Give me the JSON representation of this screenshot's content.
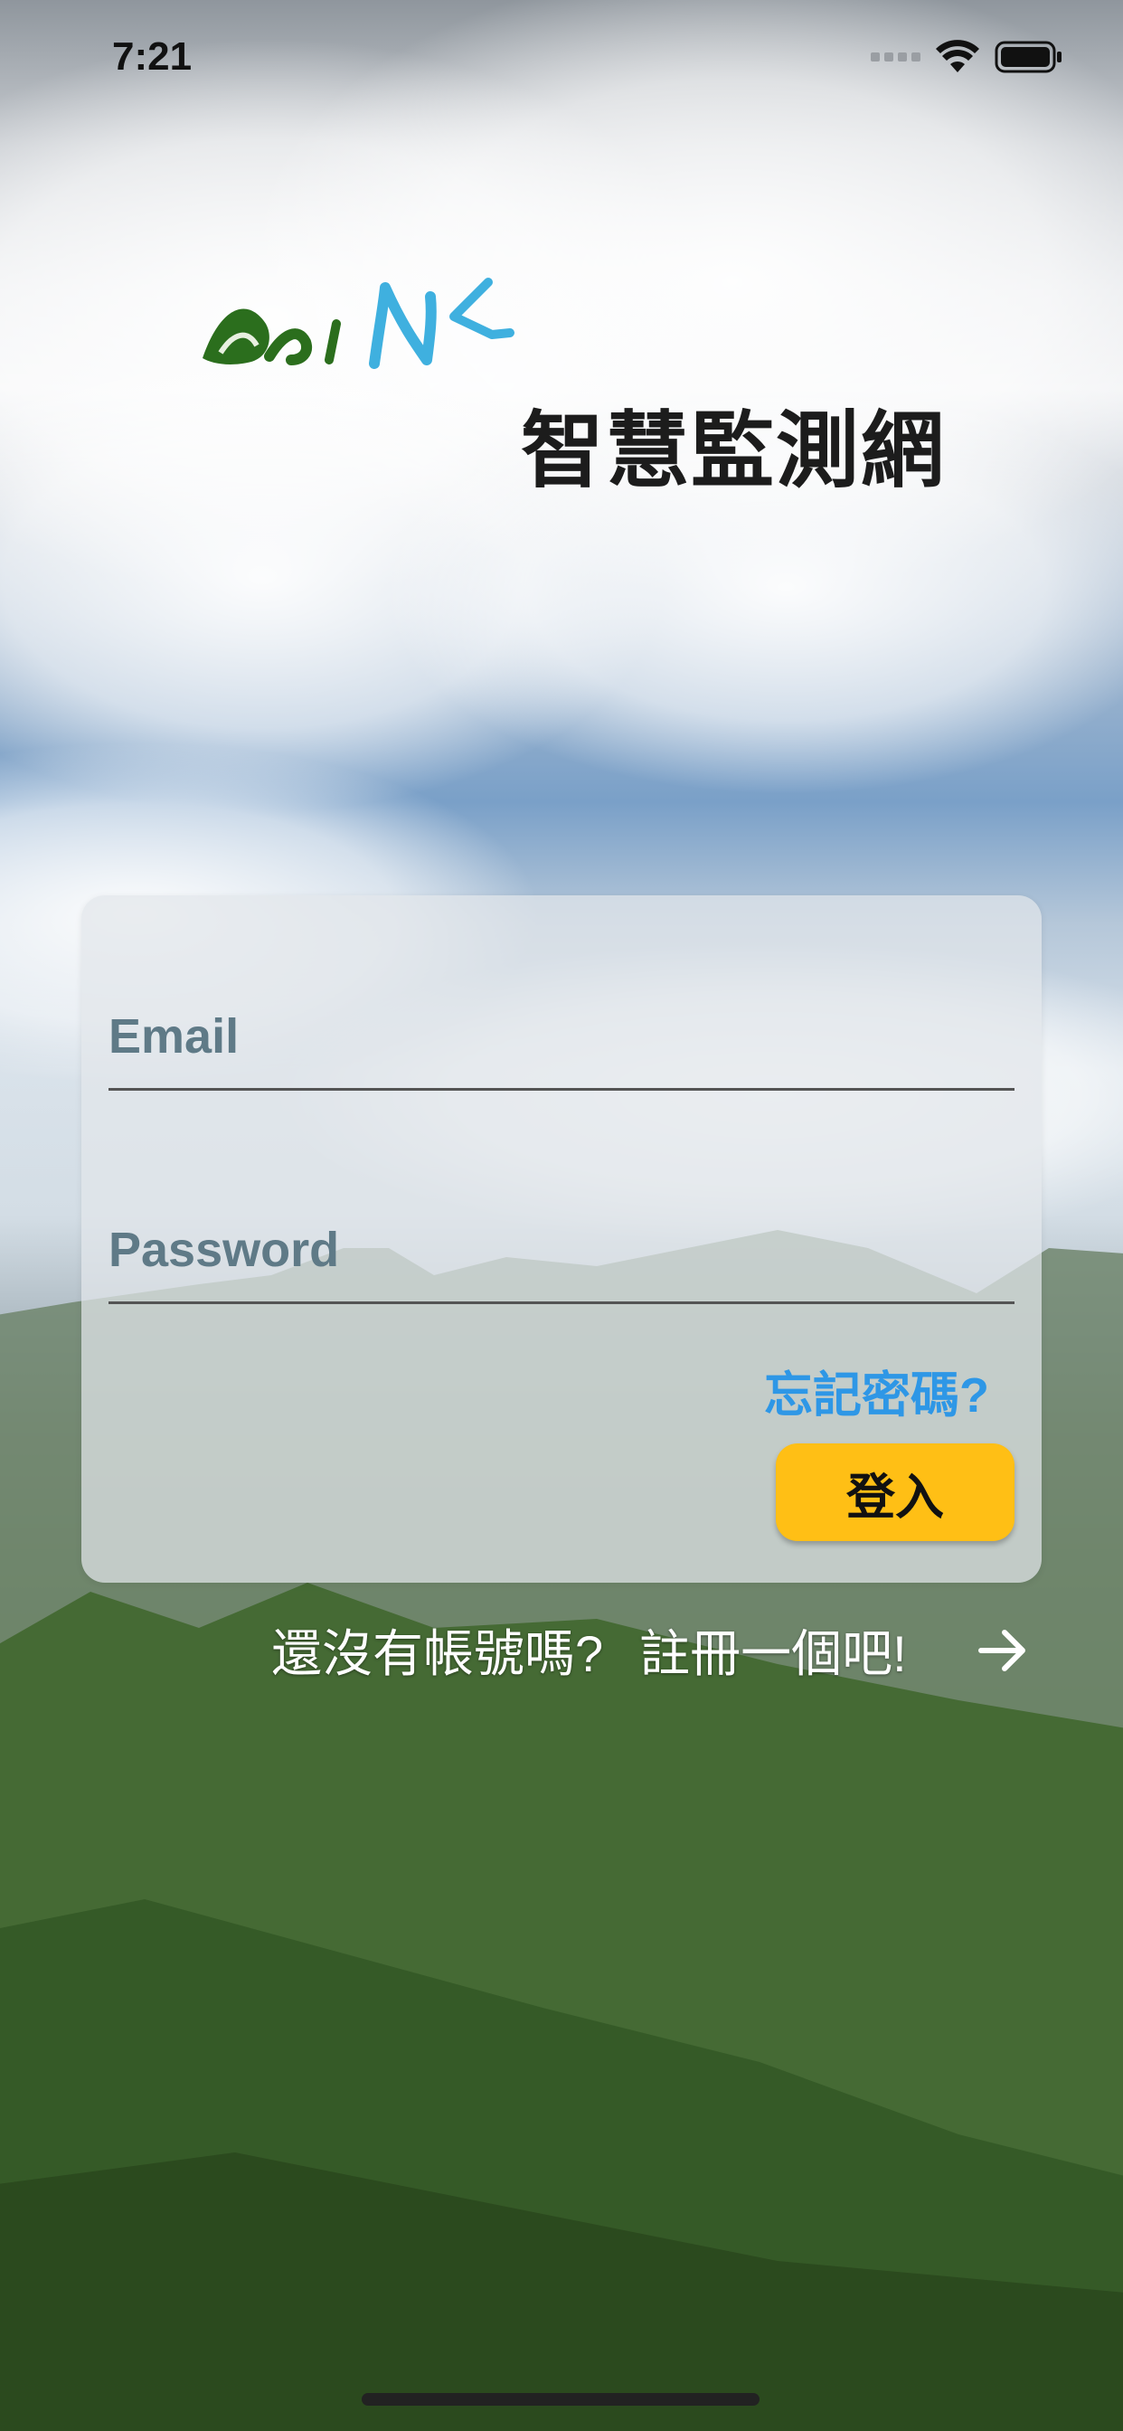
{
  "status_bar": {
    "time": "7:21",
    "icons": [
      "signal-icon",
      "wifi-icon",
      "battery-icon"
    ]
  },
  "header": {
    "logo_name": "aini-logo",
    "title": "智慧監測網"
  },
  "login_form": {
    "email_placeholder": "Email",
    "password_placeholder": "Password",
    "forgot_password_label": "忘記密碼?",
    "login_button_label": "登入"
  },
  "register": {
    "prompt": "還沒有帳號嗎?",
    "link_label": "註冊一個吧!",
    "arrow_icon": "arrow-right-icon"
  },
  "colors": {
    "accent_button": "#ffbf15",
    "link": "#2e97e6",
    "placeholder": "#5f7a87"
  }
}
